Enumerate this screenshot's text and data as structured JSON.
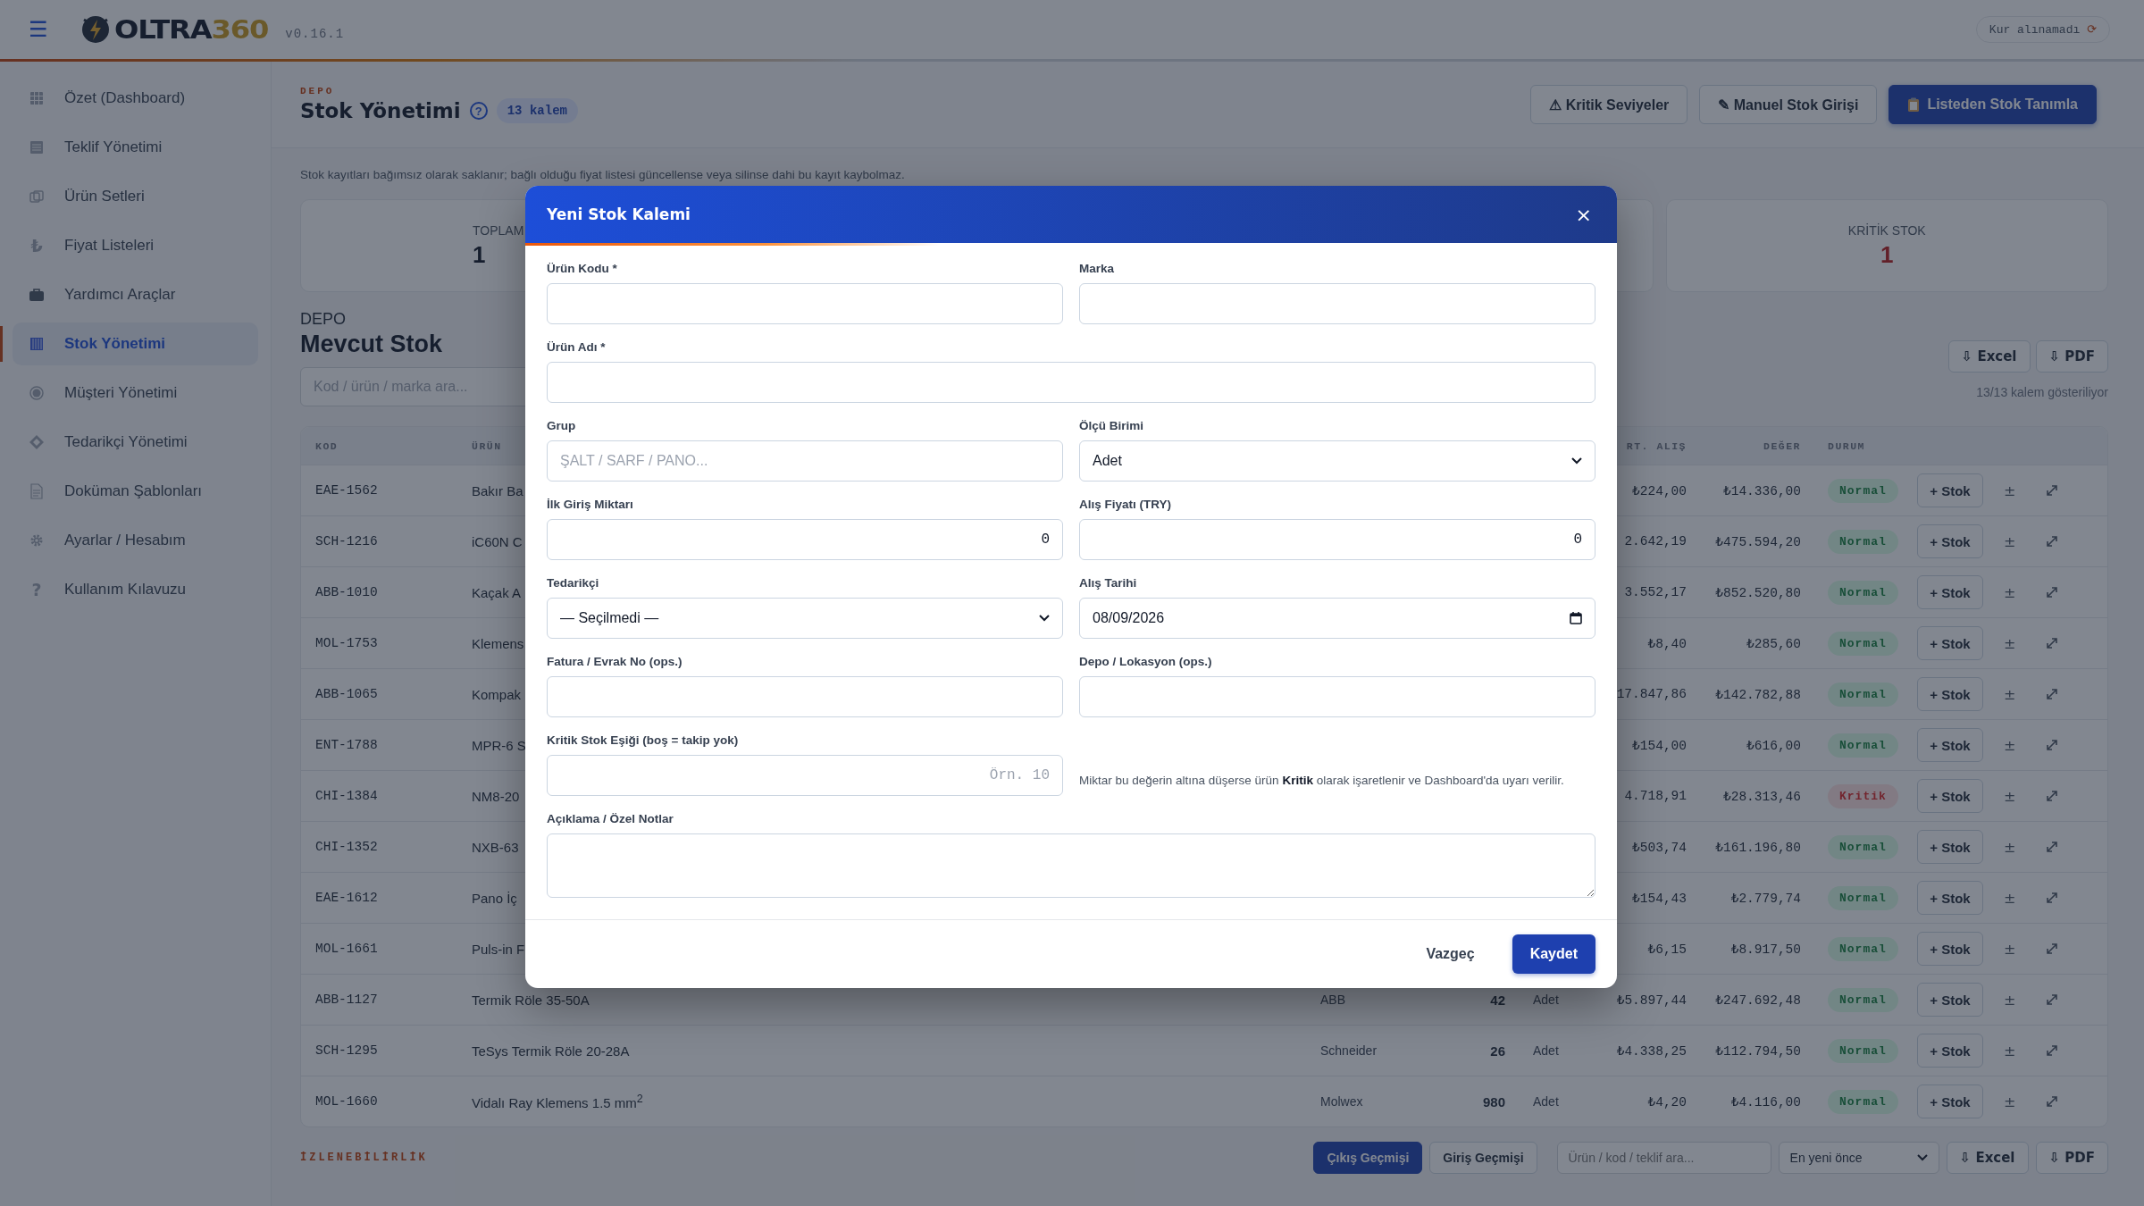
{
  "topbar": {
    "menu_icon": "☰",
    "logo": {
      "text": "OLTRA",
      "accent": "360"
    },
    "version": "v0.16.1",
    "rate_status": "Kur alınamadı",
    "rate_icon": "⟳"
  },
  "sidebar": {
    "items": [
      {
        "label": "Özet (Dashboard)",
        "kind": "grid",
        "selected": false
      },
      {
        "label": "Teklif Yönetimi",
        "kind": "list",
        "selected": false
      },
      {
        "label": "Ürün Setleri",
        "kind": "layers",
        "selected": false
      },
      {
        "label": "Fiyat Listeleri",
        "glyph": "₺",
        "selected": false
      },
      {
        "label": "Yardımcı Araçlar",
        "kind": "briefcase",
        "selected": false
      },
      {
        "label": "Stok Yönetimi",
        "kind": "columns",
        "selected": true
      },
      {
        "label": "Müşteri Yönetimi",
        "kind": "target",
        "selected": false
      },
      {
        "label": "Tedarikçi Yönetimi",
        "kind": "diamond",
        "selected": false
      },
      {
        "label": "Doküman Şablonları",
        "kind": "document",
        "selected": false
      },
      {
        "label": "Ayarlar / Hesabım",
        "kind": "gear",
        "selected": false
      },
      {
        "label": "Kullanım Kılavuzu",
        "glyph": "?",
        "selected": false
      }
    ]
  },
  "page_header": {
    "eyebrow": "DEPO",
    "title": "Stok Yönetimi",
    "help_icon": "?",
    "count_badge": "13 kalem",
    "buttons": [
      {
        "label": "⚠ Kritik Seviyeler",
        "kind": "outline"
      },
      {
        "label": "✎ Manuel Stok Girişi",
        "kind": "outline"
      },
      {
        "label": "Listeden Stok Tanımla",
        "kind": "primary"
      }
    ]
  },
  "notice": "Stok kayıtları bağımsız olarak saklanır; bağlı olduğu fiyat listesi güncellense veya silinse dahi bu kayıt kaybolmaz.",
  "stats": [
    {
      "label": "TOPLAM",
      "value": "1",
      "kind": "neutral"
    },
    {
      "label": "KRİTİK STOK",
      "value": "1",
      "kind": "critical"
    }
  ],
  "stock": {
    "eyebrow": "DEPO",
    "title": "Mevcut Stok",
    "search": {
      "placeholder": "Kod / ürün / marka ara..."
    },
    "exports": [
      "⇩ Excel",
      "⇩ PDF"
    ],
    "count": "13/13 kalem gösteriliyor",
    "columns": [
      "KOD",
      "ÜRÜN",
      "RT. ALIŞ",
      "DEĞER",
      "DURUM"
    ],
    "rows": [
      {
        "code": "EAE-1562",
        "product": "Bakır Ba",
        "avg": "₺224,00",
        "value": "₺14.336,00",
        "status": "Normal",
        "kind": "normal",
        "add": "+ Stok",
        "adjust": "±"
      },
      {
        "code": "SCH-1216",
        "product": "iC60N C",
        "avg": "2.642,19",
        "value": "₺475.594,20",
        "status": "Normal",
        "kind": "normal",
        "add": "+ Stok",
        "adjust": "±"
      },
      {
        "code": "ABB-1010",
        "product": "Kaçak A",
        "avg": "3.552,17",
        "value": "₺852.520,80",
        "status": "Normal",
        "kind": "normal",
        "add": "+ Stok",
        "adjust": "±"
      },
      {
        "code": "MOL-1753",
        "product": "Klemens",
        "avg": "₺8,40",
        "value": "₺285,60",
        "status": "Normal",
        "kind": "normal",
        "add": "+ Stok",
        "adjust": "±"
      },
      {
        "code": "ABB-1065",
        "product": "Kompak",
        "avg": "17.847,86",
        "value": "₺142.782,88",
        "status": "Normal",
        "kind": "normal",
        "add": "+ Stok",
        "adjust": "±"
      },
      {
        "code": "ENT-1788",
        "product": "MPR-6 S",
        "avg": "₺154,00",
        "value": "₺616,00",
        "status": "Normal",
        "kind": "normal",
        "add": "+ Stok",
        "adjust": "±"
      },
      {
        "code": "CHI-1384",
        "product": "NM8-20",
        "avg": "4.718,91",
        "value": "₺28.313,46",
        "status": "Kritik",
        "kind": "critical",
        "add": "+ Stok",
        "adjust": "±"
      },
      {
        "code": "CHI-1352",
        "product": "NXB-63",
        "avg": "₺503,74",
        "value": "₺161.196,80",
        "status": "Normal",
        "kind": "normal",
        "add": "+ Stok",
        "adjust": "±"
      },
      {
        "code": "EAE-1612",
        "product": "Pano İç",
        "avg": "₺154,43",
        "value": "₺2.779,74",
        "status": "Normal",
        "kind": "normal",
        "add": "+ Stok",
        "adjust": "±"
      },
      {
        "code": "MOL-1661",
        "product": "Puls-in F",
        "avg": "₺6,15",
        "value": "₺8.917,50",
        "status": "Normal",
        "kind": "normal",
        "add": "+ Stok",
        "adjust": "±"
      },
      {
        "code": "ABB-1127",
        "product": "Termik Röle 35-50A",
        "brand": "ABB",
        "qty": "42",
        "unit": "Adet",
        "avg": "₺5.897,44",
        "value": "₺247.692,48",
        "status": "Normal",
        "kind": "normal",
        "add": "+ Stok",
        "adjust": "±"
      },
      {
        "code": "SCH-1295",
        "product": "TeSys Termik Röle 20-28A",
        "brand": "Schneider",
        "qty": "26",
        "unit": "Adet",
        "avg": "₺4.338,25",
        "value": "₺112.794,50",
        "status": "Normal",
        "kind": "normal",
        "add": "+ Stok",
        "adjust": "±"
      },
      {
        "code": "MOL-1660",
        "product": "Vidalı Ray Klemens 1.5 mm$^{2}$",
        "brand": "Molwex",
        "qty": "980",
        "unit": "Adet",
        "avg": "₺4,20",
        "value": "₺4.116,00",
        "status": "Normal",
        "kind": "normal",
        "add": "+ Stok",
        "adjust": "±"
      }
    ]
  },
  "traceability": {
    "eyebrow": "İZLENEBİLİRLİK",
    "tabs": [
      {
        "label": "Çıkış Geçmişi",
        "selected": true
      },
      {
        "label": "Giriş Geçmişi",
        "selected": false
      }
    ],
    "search": {
      "placeholder": "Ürün / kod / teklif ara..."
    },
    "sort": "En yeni önce",
    "exports": [
      "⇩ Excel",
      "⇩ PDF"
    ]
  },
  "modal": {
    "title": "Yeni Stok Kalemi",
    "close_icon": "×",
    "fields": [
      {
        "label": "Ürün Kodu *",
        "kind": "text"
      },
      {
        "label": "Marka",
        "kind": "text"
      },
      {
        "label": "Ürün Adı *",
        "kind": "text",
        "wide": true
      },
      {
        "label": "Grup",
        "kind": "text",
        "placeholder": "ŞALT / SARF / PANO..."
      },
      {
        "label": "Ölçü Birimi",
        "kind": "select",
        "value": "Adet"
      },
      {
        "label": "İlk Giriş Miktarı",
        "kind": "number",
        "value": "0"
      },
      {
        "label": "Alış Fiyatı (TRY)",
        "kind": "number",
        "value": "0"
      },
      {
        "label": "Tedarikçi",
        "kind": "select",
        "value": "— Seçilmedi —"
      },
      {
        "label": "Alış Tarihi",
        "kind": "date",
        "value": "08/09/2026"
      },
      {
        "label": "Fatura / Evrak No (ops.)",
        "kind": "text"
      },
      {
        "label": "Depo / Lokasyon (ops.)",
        "kind": "text"
      },
      {
        "label": "Kritik Stok Eşiği (boş = takip yok)",
        "kind": "number",
        "placeholder": "Örn. 10"
      },
      {
        "kind": "note",
        "text": "Miktar bu değerin altına düşerse ürün **Kritik** olarak işaretlenir ve Dashboard'da uyarı verilir."
      },
      {
        "label": "Açıklama / Özel Notlar",
        "kind": "textarea",
        "wide": true
      }
    ],
    "buttons": [
      {
        "label": "Vazgeç",
        "kind": "plain"
      },
      {
        "label": "Kaydet",
        "kind": "primary"
      }
    ]
  }
}
